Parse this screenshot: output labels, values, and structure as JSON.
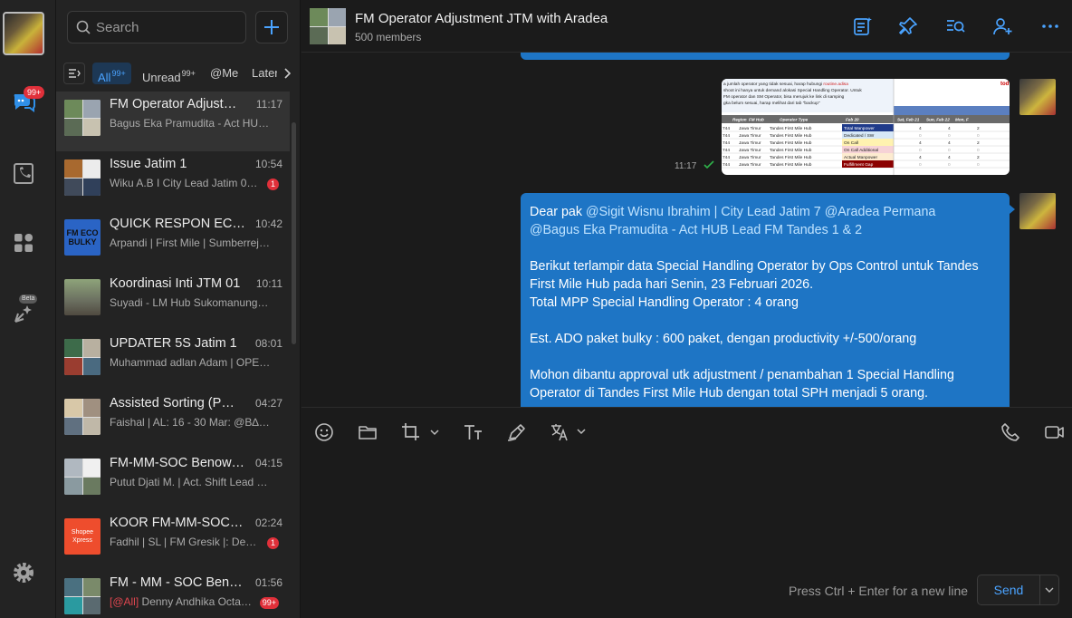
{
  "rail": {
    "badge": "99+",
    "beta": "Beta"
  },
  "sidebar": {
    "search_placeholder": "Search",
    "filters": [
      {
        "label": "All",
        "count": "99+"
      },
      {
        "label": "Unread",
        "count": "99+"
      },
      {
        "label": "@Me",
        "count": ""
      },
      {
        "label": "Later",
        "count": ""
      }
    ],
    "chats": [
      {
        "title": "FM Operator Adjustm…",
        "time": "11:17",
        "preview": "Bagus Eka Pramudita - Act HU…",
        "badge": ""
      },
      {
        "title": "Issue Jatim 1",
        "time": "10:54",
        "preview": "Wiku A.B I City Lead Jatim 0…",
        "badge": "1"
      },
      {
        "title": "QUICK RESPON EC…",
        "time": "10:42",
        "preview": "Arpandi | First Mile | Sumberrej…",
        "badge": "",
        "avatar_text": "FM ECO BULKY"
      },
      {
        "title": "Koordinasi Inti JTM 01",
        "time": "10:11",
        "preview": "Suyadi - LM Hub Sukomanung…",
        "badge": ""
      },
      {
        "title": "UPDATER 5S Jatim 1",
        "time": "08:01",
        "preview": "Muhammad adlan Adam | OPE…",
        "badge": ""
      },
      {
        "title": "Assisted Sorting (PW…",
        "time": "04:27",
        "preview": "Faishal | AL: 16 - 30 Mar: @B∆…",
        "badge": ""
      },
      {
        "title": "FM-MM-SOC Benow…",
        "time": "04:15",
        "preview": "Putut Djati M. | Act. Shift Lead F…",
        "badge": ""
      },
      {
        "title": "KOOR FM-MM-SOC …",
        "time": "02:24",
        "preview": "Fadhil | SL | FM Gresik |: De…",
        "badge": "1",
        "avatar_text": "Shopee Xpress"
      },
      {
        "title": "FM - MM - SOC Ben…",
        "time": "01:56",
        "mention": "[@All]",
        "preview": " Denny Andhika Octa…",
        "badge": "99+"
      }
    ]
  },
  "header": {
    "title": "FM Operator Adjustment JTM with Aradea",
    "members": "500 members"
  },
  "messages": {
    "image_time": "11:17",
    "sheet": {
      "notice": [
        "a jumlah operator yang tidak sesuai, harap hubungi",
        "shoot ini hanya untuk demand alokasi Special Handling Operator. Untuk",
        "FM operator dan SM Operator, bisa merujuk ke link di samping",
        "gka belum sesuai, harap melihat dari tab \"backup\""
      ],
      "notice_red": "routine.adisa",
      "top_right": "tod",
      "headers": [
        "Region",
        "FM Hub",
        "Operator Type",
        "Feb 20",
        "Sat, Feb 21",
        "Sun, Feb 22",
        "Mon, F"
      ],
      "rows": [
        [
          "744",
          "Jawa Timur",
          "Tandes First Mile Hub",
          "Total Manpower",
          "4",
          "4",
          "2"
        ],
        [
          "744",
          "Jawa Timur",
          "Tandes First Mile Hub",
          "Dedicated / SW",
          "0",
          "0",
          "0"
        ],
        [
          "744",
          "Jawa Timur",
          "Tandes First Mile Hub",
          "On Call",
          "4",
          "4",
          "2"
        ],
        [
          "744",
          "Jawa Timur",
          "Tandes First Mile Hub",
          "On Call Additional",
          "0",
          "0",
          "0"
        ],
        [
          "744",
          "Jawa Timur",
          "Tandes First Mile Hub",
          "Actual Manpower",
          "4",
          "4",
          "2"
        ],
        [
          "744",
          "Jawa Timur",
          "Tandes First Mile Hub",
          "Fulfillment Gap",
          "0",
          "0",
          "0"
        ]
      ]
    },
    "bubble": {
      "greeting": "Dear pak ",
      "mention1": "@Sigit Wisnu Ibrahim | City Lead Jatim 7",
      "mention2": "@Aradea Permana",
      "mention3": "@Bagus Eka Pramudita - Act HUB Lead FM Tandes 1 & 2",
      "p1": "Berikut terlampir data Special Handling Operator by Ops Control untuk Tandes First Mile Hub pada hari Senin, 23 Februari 2026.",
      "p2": "Total MPP Special Handling Operator : 4 orang",
      "p3": "Est. ADO paket bulky : 600 paket, dengan productivity +/-500/orang",
      "p4": "Mohon dibantu approval utk adjustment / penambahan 1 Special Handling Operator di Tandes First Mile Hub dengan total SPH menjadi 5 orang."
    }
  },
  "composer": {
    "hint": "Press Ctrl + Enter for a new line",
    "send_label": "Send"
  },
  "colors": {
    "accent": "#4aa3ff",
    "bubble": "#1e75c5",
    "badge": "#e0303a"
  }
}
